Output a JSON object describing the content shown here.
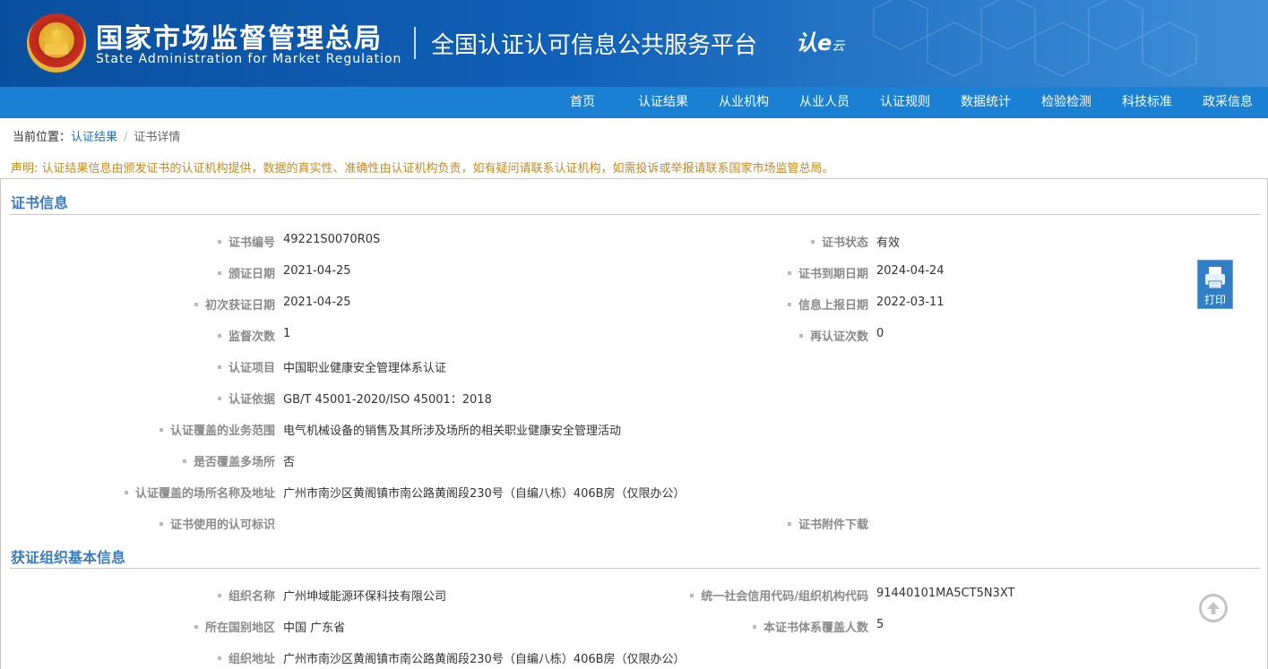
{
  "header": {
    "agency_cn": "国家市场监督管理总局",
    "agency_en": "State Administration  for  Market Regulation",
    "platform": "全国认证认可信息公共服务平台",
    "logo_text": "认e",
    "logo_sub": "云"
  },
  "nav": {
    "items": [
      {
        "label": "首页"
      },
      {
        "label": "认证结果"
      },
      {
        "label": "从业机构"
      },
      {
        "label": "从业人员"
      },
      {
        "label": "认证规则"
      },
      {
        "label": "数据统计"
      },
      {
        "label": "检验检测"
      },
      {
        "label": "科技标准"
      },
      {
        "label": "政采信息"
      }
    ]
  },
  "breadcrumb": {
    "prefix": "当前位置：",
    "link": "认证结果",
    "sep": "/",
    "current": "证书详情"
  },
  "notice": "声明: 认证结果信息由颁发证书的认证机构提供，数据的真实性、准确性由认证机构负责，如有疑问请联系认证机构，如需投诉或举报请联系国家市场监管总局。",
  "cert_section": {
    "title": "证书信息",
    "cert_no_label": "证书编号",
    "cert_no": "49221S0070R0S",
    "status_label": "证书状态",
    "status": "有效",
    "issue_date_label": "颁证日期",
    "issue_date": "2021-04-25",
    "expire_label": "证书到期日期",
    "expire_date": "2024-04-24",
    "first_date_label": "初次获证日期",
    "first_date": "2021-04-25",
    "report_date_label": "信息上报日期",
    "report_date": "2022-03-11",
    "supervise_label": "监督次数",
    "supervise_count": "1",
    "recert_label": "再认证次数",
    "recert_count": "0",
    "project_label": "认证项目",
    "project": "中国职业健康安全管理体系认证",
    "basis_label": "认证依据",
    "basis": "GB/T 45001-2020/ISO 45001：2018",
    "scope_label": "认证覆盖的业务范围",
    "scope": "电气机械设备的销售及其所涉及场所的相关职业健康安全管理活动",
    "multi_site_label": "是否覆盖多场所",
    "multi_site": "否",
    "site_label": "认证覆盖的场所名称及地址",
    "site": "广州市南沙区黄阁镇市南公路黄阁段230号（自编八栋）406B房（仅限办公）",
    "mark_label": "证书使用的认可标识",
    "attach_label": "证书附件下载"
  },
  "org_section": {
    "title": "获证组织基本信息",
    "name_label": "组织名称",
    "name": "广州坤域能源环保科技有限公司",
    "credit_label": "统一社会信用代码/组织机构代码",
    "credit_code": "91440101MA5CT5N3XT",
    "region_label": "所在国别地区",
    "region": "中国 广东省",
    "headcount_label": "本证书体系覆盖人数",
    "headcount": "5",
    "address_label": "组织地址",
    "address": "广州市南沙区黄阁镇市南公路黄阁段230号（自编八栋）406B房（仅限办公）"
  },
  "print_label": "打印",
  "icons": {
    "print": "printer-icon",
    "top": "arrow-up-circle-icon"
  }
}
